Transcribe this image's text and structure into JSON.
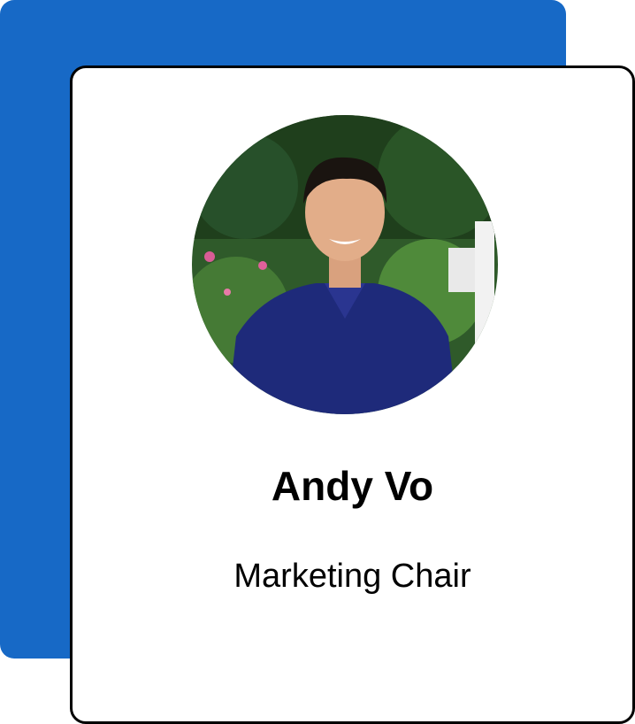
{
  "profile": {
    "name": "Andy Vo",
    "role": "Marketing Chair",
    "photo_icon": "profile-photo",
    "accent_color": "#1769c6"
  }
}
